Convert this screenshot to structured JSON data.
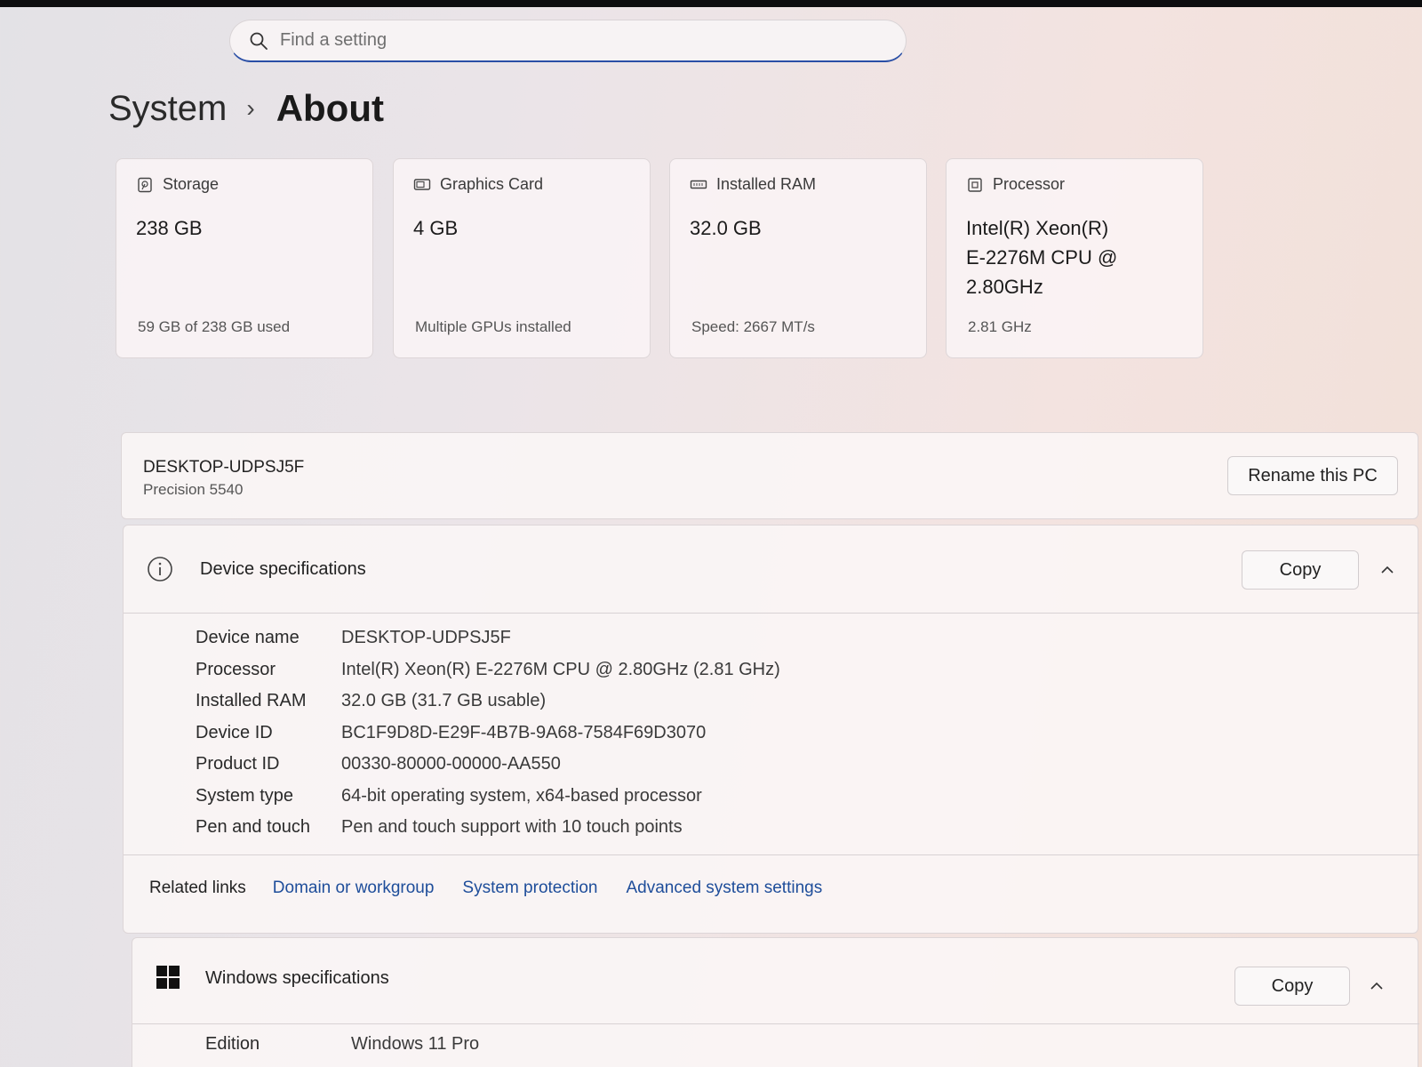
{
  "search": {
    "placeholder": "Find a setting",
    "icon": "search-icon"
  },
  "breadcrumb": {
    "parent": "System",
    "separator": "›",
    "current": "About"
  },
  "cards": [
    {
      "icon": "storage-icon",
      "title": "Storage",
      "value": "238 GB",
      "sub": "59 GB of 238 GB used"
    },
    {
      "icon": "graphics-card-icon",
      "title": "Graphics Card",
      "value": "4 GB",
      "sub": "Multiple GPUs installed"
    },
    {
      "icon": "ram-icon",
      "title": "Installed RAM",
      "value": "32.0 GB",
      "sub": "Speed: 2667 MT/s"
    },
    {
      "icon": "processor-icon",
      "title": "Processor",
      "value_lines": [
        "Intel(R) Xeon(R)",
        "E-2276M  CPU @",
        "2.80GHz"
      ],
      "sub": "2.81 GHz"
    }
  ],
  "pc": {
    "name": "DESKTOP-UDPSJ5F",
    "model": "Precision 5540",
    "rename_label": "Rename this PC"
  },
  "device_specs": {
    "title": "Device specifications",
    "copy_label": "Copy",
    "rows": [
      {
        "label": "Device name",
        "value": "DESKTOP-UDPSJ5F"
      },
      {
        "label": "Processor",
        "value": "Intel(R) Xeon(R) E-2276M  CPU @ 2.80GHz (2.81 GHz)"
      },
      {
        "label": "Installed RAM",
        "value": "32.0 GB (31.7 GB usable)"
      },
      {
        "label": "Device ID",
        "value": "BC1F9D8D-E29F-4B7B-9A68-7584F69D3070"
      },
      {
        "label": "Product ID",
        "value": "00330-80000-00000-AA550"
      },
      {
        "label": "System type",
        "value": "64-bit operating system, x64-based processor"
      },
      {
        "label": "Pen and touch",
        "value": "Pen and touch support with 10 touch points"
      }
    ]
  },
  "related_links": {
    "label": "Related links",
    "links": [
      "Domain or workgroup",
      "System protection",
      "Advanced system settings"
    ]
  },
  "windows_specs": {
    "title": "Windows specifications",
    "copy_label": "Copy",
    "rows": [
      {
        "label": "Edition",
        "value": "Windows 11 Pro"
      }
    ]
  },
  "colors": {
    "accent": "#2a4fa6",
    "link": "#1e4d9a"
  }
}
